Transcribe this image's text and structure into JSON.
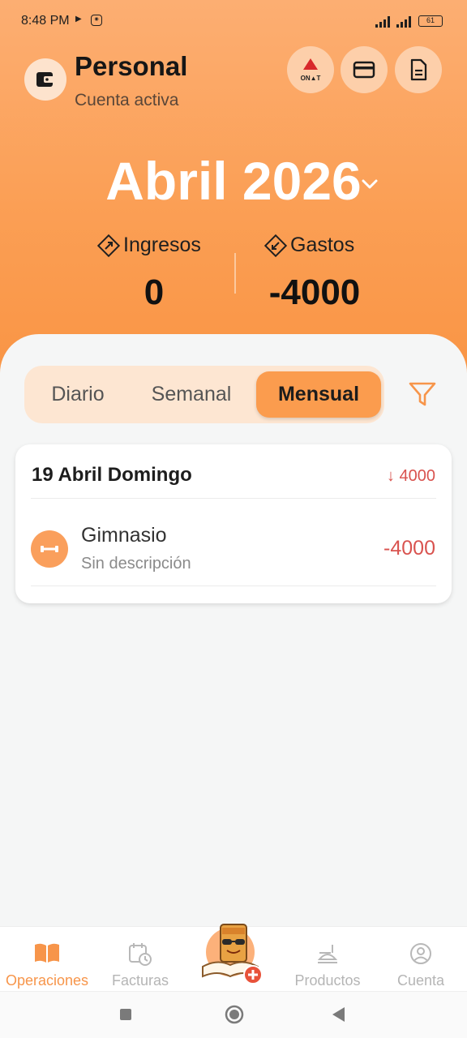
{
  "status": {
    "time": "8:48 PM",
    "battery": "61"
  },
  "account": {
    "name": "Personal",
    "subtitle": "Cuenta activa",
    "onat_label": "ON▲T"
  },
  "period": {
    "month_label": "Abril 2026"
  },
  "summary": {
    "income_label": "Ingresos",
    "income_value": "0",
    "expense_label": "Gastos",
    "expense_value": "-4000"
  },
  "tabs": [
    {
      "label": "Diario",
      "active": false
    },
    {
      "label": "Semanal",
      "active": false
    },
    {
      "label": "Mensual",
      "active": true
    }
  ],
  "day_group": {
    "date": "19 Abril Domingo",
    "total": "↓ 4000",
    "transactions": [
      {
        "name": "Gimnasio",
        "description": "Sin descripción",
        "amount": "-4000",
        "icon": "dumbbell-icon"
      }
    ]
  },
  "nav": [
    {
      "label": "Operaciones",
      "icon": "book-icon",
      "active": true
    },
    {
      "label": "Facturas",
      "icon": "calendar-clock-icon",
      "active": false
    },
    {
      "label": "",
      "icon": "mascot-add-icon",
      "active": false
    },
    {
      "label": "Productos",
      "icon": "products-icon",
      "active": false
    },
    {
      "label": "Cuenta",
      "icon": "user-circle-icon",
      "active": false
    }
  ],
  "colors": {
    "accent": "#f99545",
    "expense": "#d9534f",
    "header_top": "#fcae72"
  }
}
